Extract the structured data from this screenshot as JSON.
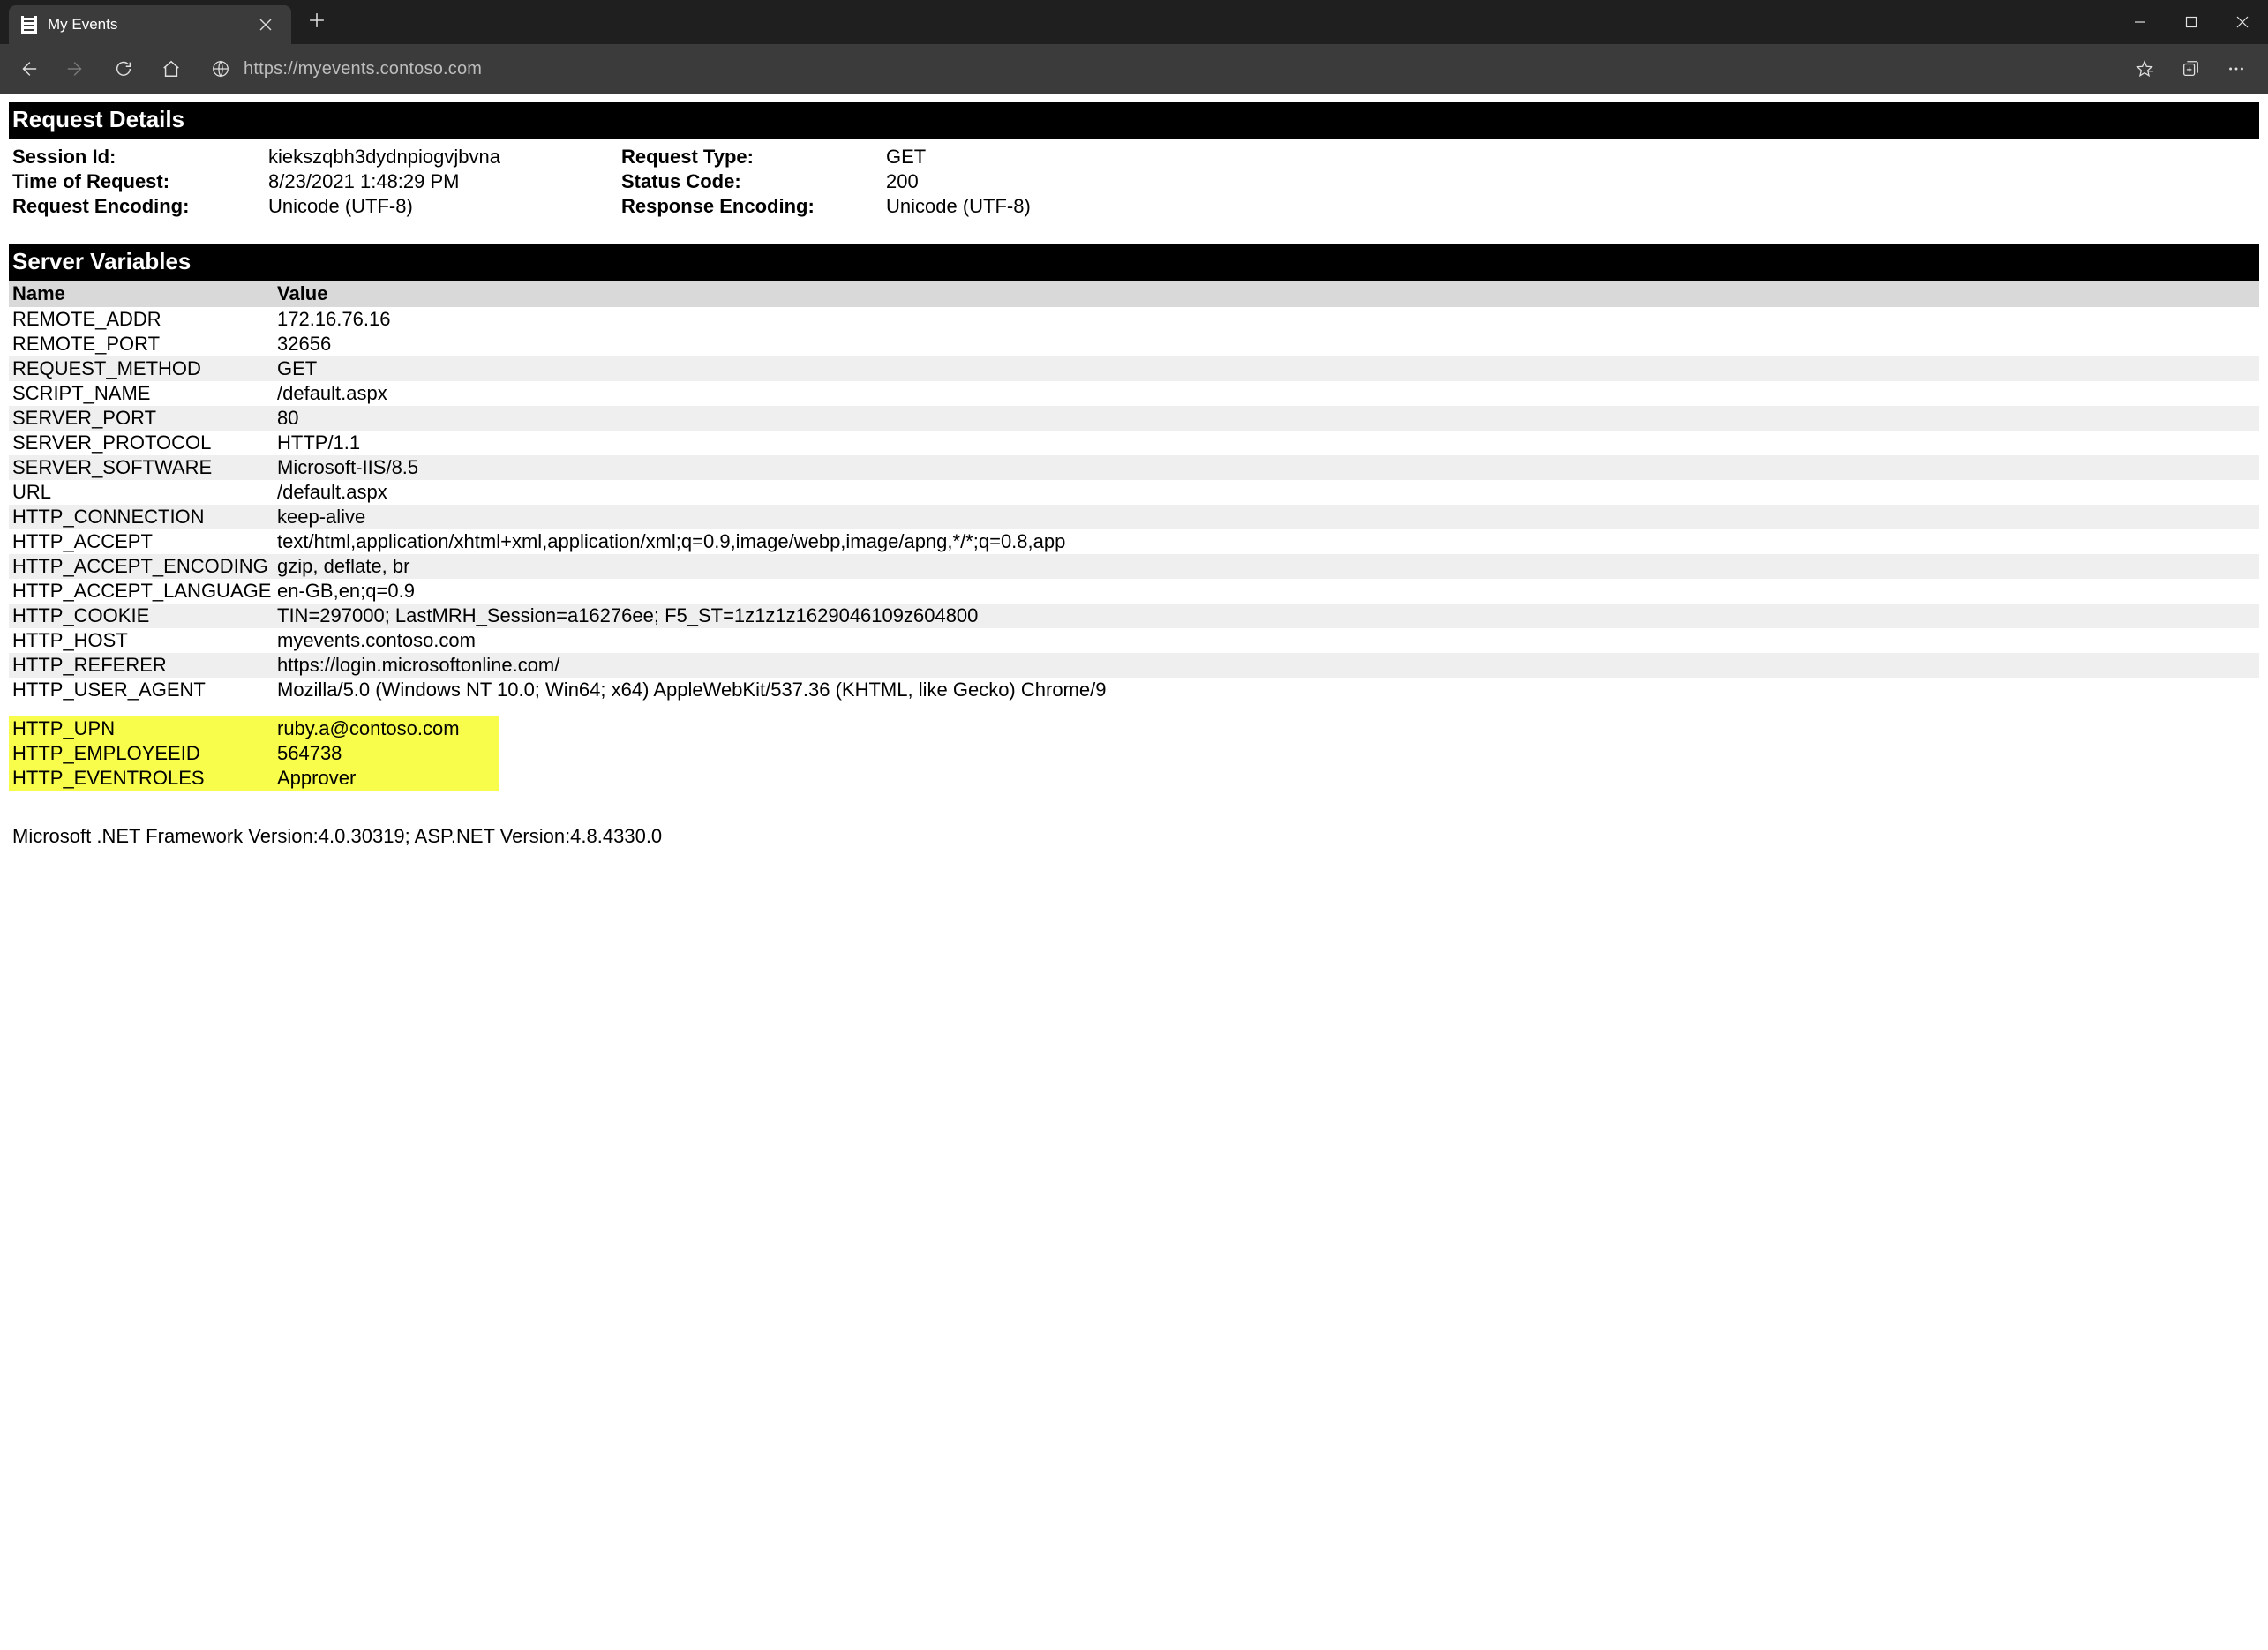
{
  "browser": {
    "tab_title": "My Events",
    "url": "https://myevents.contoso.com"
  },
  "sections": {
    "request_details_title": "Request Details",
    "server_variables_title": "Server Variables"
  },
  "request": {
    "session_id_label": "Session Id:",
    "session_id": "kiekszqbh3dydnpiogvjbvna",
    "time_label": "Time of Request:",
    "time": "8/23/2021 1:48:29 PM",
    "req_encoding_label": "Request Encoding:",
    "req_encoding": "Unicode (UTF-8)",
    "type_label": "Request Type:",
    "type": "GET",
    "status_label": "Status Code:",
    "status": "200",
    "resp_encoding_label": "Response Encoding:",
    "resp_encoding": "Unicode (UTF-8)"
  },
  "vars_header": {
    "name": "Name",
    "value": "Value"
  },
  "vars": [
    {
      "name": "REMOTE_ADDR",
      "value": "172.16.76.16"
    },
    {
      "name": "REMOTE_PORT",
      "value": "32656"
    },
    {
      "name": "REQUEST_METHOD",
      "value": "GET"
    },
    {
      "name": "SCRIPT_NAME",
      "value": "/default.aspx"
    },
    {
      "name": "SERVER_PORT",
      "value": "80"
    },
    {
      "name": "SERVER_PROTOCOL",
      "value": "HTTP/1.1"
    },
    {
      "name": "SERVER_SOFTWARE",
      "value": "Microsoft-IIS/8.5"
    },
    {
      "name": "URL",
      "value": "/default.aspx"
    },
    {
      "name": "HTTP_CONNECTION",
      "value": "keep-alive"
    },
    {
      "name": "HTTP_ACCEPT",
      "value": "text/html,application/xhtml+xml,application/xml;q=0.9,image/webp,image/apng,*/*;q=0.8,app"
    },
    {
      "name": "HTTP_ACCEPT_ENCODING",
      "value": "gzip, deflate, br"
    },
    {
      "name": "HTTP_ACCEPT_LANGUAGE",
      "value": "en-GB,en;q=0.9"
    },
    {
      "name": "HTTP_COOKIE",
      "value": "TIN=297000; LastMRH_Session=a16276ee; F5_ST=1z1z1z1629046109z604800"
    },
    {
      "name": "HTTP_HOST",
      "value": "myevents.contoso.com"
    },
    {
      "name": "HTTP_REFERER",
      "value": "https://login.microsoftonline.com/"
    },
    {
      "name": "HTTP_USER_AGENT",
      "value": "Mozilla/5.0 (Windows NT 10.0; Win64; x64) AppleWebKit/537.36 (KHTML, like Gecko) Chrome/9"
    }
  ],
  "highlight_vars": [
    {
      "name": "HTTP_UPN",
      "value": "ruby.a@contoso.com"
    },
    {
      "name": "HTTP_EMPLOYEEID",
      "value": "564738"
    },
    {
      "name": "HTTP_EVENTROLES",
      "value": "Approver"
    }
  ],
  "footer": "Microsoft .NET Framework Version:4.0.30319; ASP.NET Version:4.8.4330.0"
}
